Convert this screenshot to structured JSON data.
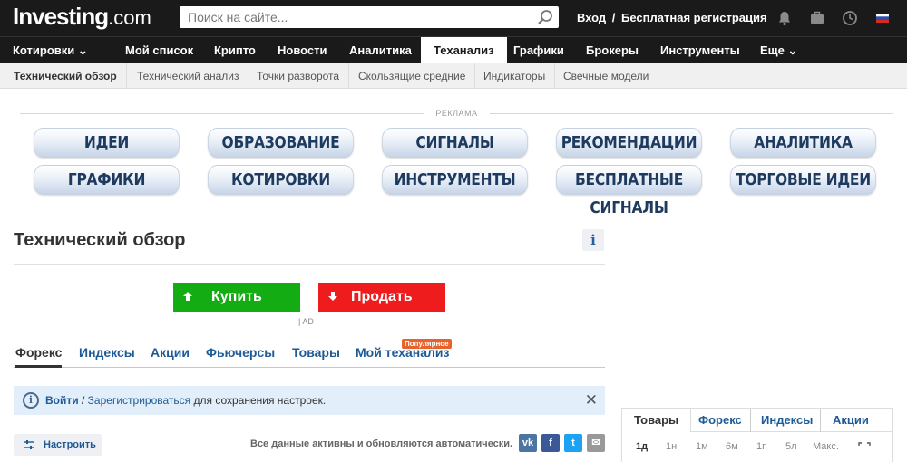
{
  "header": {
    "logo_main": "Investing",
    "logo_suffix": ".com",
    "search_placeholder": "Поиск на сайте...",
    "login": "Вход",
    "login_sep": "/",
    "register": "Бесплатная регистрация",
    "icons": [
      "bell-icon",
      "briefcase-icon",
      "clock-icon",
      "russian-flag-icon"
    ]
  },
  "mainnav": {
    "items": [
      {
        "label": "Котировки ⌄"
      },
      {
        "label": "Мой список"
      },
      {
        "label": "Крипто"
      },
      {
        "label": "Новости"
      },
      {
        "label": "Аналитика"
      },
      {
        "label": "Теханализ"
      },
      {
        "label": "Графики"
      },
      {
        "label": "Брокеры"
      },
      {
        "label": "Инструменты"
      },
      {
        "label": "Еще ⌄"
      }
    ]
  },
  "subnav": {
    "items": [
      {
        "label": "Технический обзор"
      },
      {
        "label": "Технический анализ"
      },
      {
        "label": "Точки разворота"
      },
      {
        "label": "Скользящие средние"
      },
      {
        "label": "Индикаторы"
      },
      {
        "label": "Свечные модели"
      }
    ]
  },
  "ad": {
    "label": "РЕКЛАМА",
    "buttons_row1": [
      "ИДЕИ",
      "ОБРАЗОВАНИЕ",
      "СИГНАЛЫ",
      "РЕКОМЕНДАЦИИ",
      "АНАЛИТИКА"
    ],
    "buttons_row2": [
      "ГРАФИКИ",
      "КОТИРОВКИ",
      "ИНСТРУМЕНТЫ",
      "БЕСПЛАТНЫЕ СИГНАЛЫ",
      "ТОРГОВЫЕ ИДЕИ"
    ]
  },
  "page": {
    "title": "Технический обзор",
    "info_symbol": "i"
  },
  "trade": {
    "buy_label": "Купить",
    "sell_label": "Продать",
    "ad_tag": "| AD |"
  },
  "categories": {
    "tabs": [
      {
        "label": "Форекс"
      },
      {
        "label": "Индексы"
      },
      {
        "label": "Акции"
      },
      {
        "label": "Фьючерсы"
      },
      {
        "label": "Товары"
      },
      {
        "label": "Мой теханализ"
      }
    ],
    "popular_badge": "Популярное"
  },
  "banner": {
    "icon_symbol": "i",
    "login_link": "Войти",
    "separator": "/",
    "register_link": "Зарегистрироваться",
    "text": "для сохранения настроек.",
    "close_symbol": "✕"
  },
  "toolbar": {
    "configure_label": "Настроить",
    "auto_text": "Все данные активны и обновляются автоматически.",
    "social": [
      {
        "icon": "vk-icon",
        "glyph": "vk",
        "color": "#4c75a3"
      },
      {
        "icon": "facebook-icon",
        "glyph": "f",
        "color": "#3b5998"
      },
      {
        "icon": "twitter-icon",
        "glyph": "t",
        "color": "#1da1f2"
      },
      {
        "icon": "email-icon",
        "glyph": "✉",
        "color": "#999999"
      }
    ]
  },
  "widget": {
    "tabs": [
      {
        "label": "Товары"
      },
      {
        "label": "Форекс"
      },
      {
        "label": "Индексы"
      },
      {
        "label": "Акции"
      }
    ],
    "periods": [
      "1д",
      "1н",
      "1м",
      "6м",
      "1г",
      "5л",
      "Макс."
    ]
  },
  "colors": {
    "header_bg": "#1a1a1a",
    "buy": "#13ac13",
    "sell": "#ee1c1c",
    "link": "#1d5a96",
    "popular_badge": "#e8632b",
    "banner_bg": "#e3eefb"
  }
}
